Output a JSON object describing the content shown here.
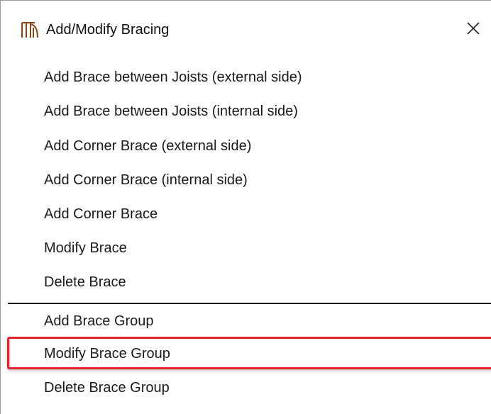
{
  "dialog": {
    "title": "Add/Modify Bracing",
    "icon": "bracing-icon",
    "close_icon": "close-icon"
  },
  "menu": {
    "items": [
      {
        "label": "Add Brace between Joists (external side)"
      },
      {
        "label": "Add Brace between Joists (internal side)"
      },
      {
        "label": "Add Corner Brace (external side)"
      },
      {
        "label": "Add Corner Brace (internal side)"
      },
      {
        "label": "Add Corner Brace"
      },
      {
        "label": "Modify Brace"
      },
      {
        "label": "Delete Brace"
      },
      {
        "label": "Add Brace Group"
      },
      {
        "label": "Modify Brace Group",
        "highlighted": true
      },
      {
        "label": "Delete Brace Group"
      }
    ]
  },
  "colors": {
    "highlight_border": "#e8232a",
    "icon_color": "#8b4513"
  }
}
